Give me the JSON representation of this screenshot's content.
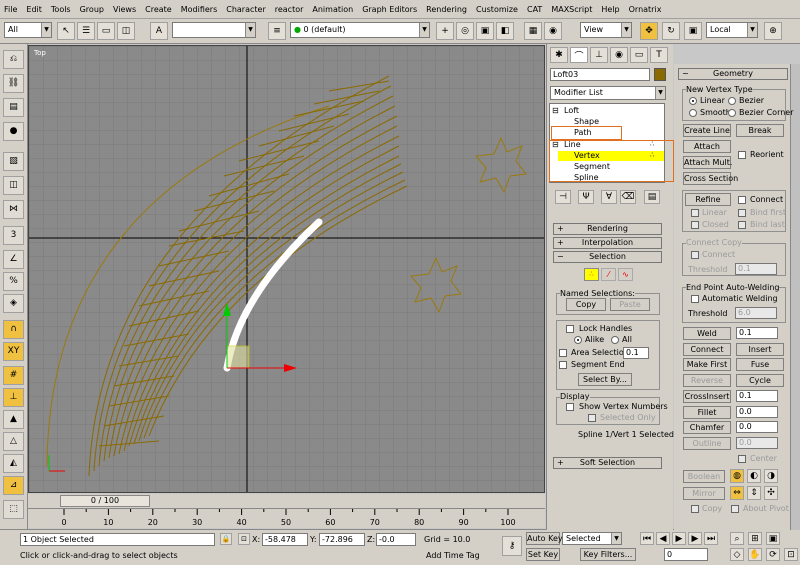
{
  "menu": [
    "File",
    "Edit",
    "Tools",
    "Group",
    "Views",
    "Create",
    "Modifiers",
    "Character",
    "reactor",
    "Animation",
    "Graph Editors",
    "Rendering",
    "Customize",
    "CAT",
    "MAXScript",
    "Help",
    "Ornatrix"
  ],
  "toolbar": {
    "filter": "All",
    "layer": "0 (default)",
    "view": "View",
    "coord": "Local"
  },
  "viewport": {
    "label": "Top",
    "cross_color": "#000000",
    "spline_color": "#ffffff",
    "loft_color": "#8a6a00"
  },
  "timeline": {
    "frame": "0 / 100",
    "ticks": [
      "0",
      "10",
      "20",
      "30",
      "40",
      "50",
      "60",
      "70",
      "80",
      "90",
      "100"
    ]
  },
  "status": {
    "selected": "1 Object Selected",
    "prompt": "Click or click-and-drag to select objects",
    "x_label": "X:",
    "x": "-58.478",
    "y_label": "Y:",
    "y": "-72.896",
    "z_label": "Z:",
    "z": "-0.0",
    "grid": "Grid = 10.0",
    "add_time_tag": "Add Time Tag",
    "auto_key": "Auto Key",
    "key_mode": "Selected",
    "set_key": "Set Key",
    "key_filters": "Key Filters...",
    "frame": "0"
  },
  "cmd": {
    "object_name": "Loft03",
    "modifier_list": "Modifier List",
    "stack": [
      "Loft",
      "Shape",
      "Path",
      "Line",
      "Vertex",
      "Segment",
      "Spline"
    ],
    "rollouts": {
      "rendering": "Rendering",
      "interpolation": "Interpolation",
      "selection": "Selection",
      "soft": "Soft Selection"
    },
    "named_selections": "Named Selections:",
    "copy": "Copy",
    "paste": "Paste",
    "lock_handles": "Lock Handles",
    "alike": "Alike",
    "all": "All",
    "area_selection": "Area Selection:",
    "area_value": "0.1",
    "segment_end": "Segment End",
    "select_by": "Select By...",
    "display": "Display",
    "show_vertex_numbers": "Show Vertex Numbers",
    "selected_only": "Selected Only",
    "sel_status": "Spline 1/Vert 1 Selected"
  },
  "geometry": {
    "title": "Geometry",
    "new_vertex_type": "New Vertex Type",
    "linear": "Linear",
    "bezier": "Bezier",
    "smooth": "Smooth",
    "bezier_corner": "Bezier Corner",
    "create_line": "Create Line",
    "break": "Break",
    "attach": "Attach",
    "reorient": "Reorient",
    "attach_mult": "Attach Mult.",
    "cross_section": "Cross Section",
    "refine": "Refine",
    "connect_cb": "Connect",
    "linear_cb": "Linear",
    "bind_first": "Bind first",
    "closed": "Closed",
    "bind_last": "Bind last",
    "connect_copy": "Connect Copy",
    "connect_cc": "Connect",
    "threshold": "Threshold",
    "threshold_val": "0.1",
    "end_point": "End Point Auto-Welding",
    "auto_weld": "Automatic Welding",
    "threshold2": "Threshold",
    "threshold2_val": "6.0",
    "weld": "Weld",
    "weld_val": "0.1",
    "connect": "Connect",
    "insert": "Insert",
    "make_first": "Make First",
    "fuse": "Fuse",
    "reverse": "Reverse",
    "cycle": "Cycle",
    "crossinsert": "CrossInsert",
    "crossinsert_val": "0.1",
    "fillet": "Fillet",
    "fillet_val": "0.0",
    "chamfer": "Chamfer",
    "chamfer_val": "0.0",
    "outline": "Outline",
    "outline_val": "0.0",
    "center": "Center",
    "boolean": "Boolean",
    "mirror": "Mirror",
    "copy": "Copy",
    "about_pivot": "About Pivot"
  }
}
